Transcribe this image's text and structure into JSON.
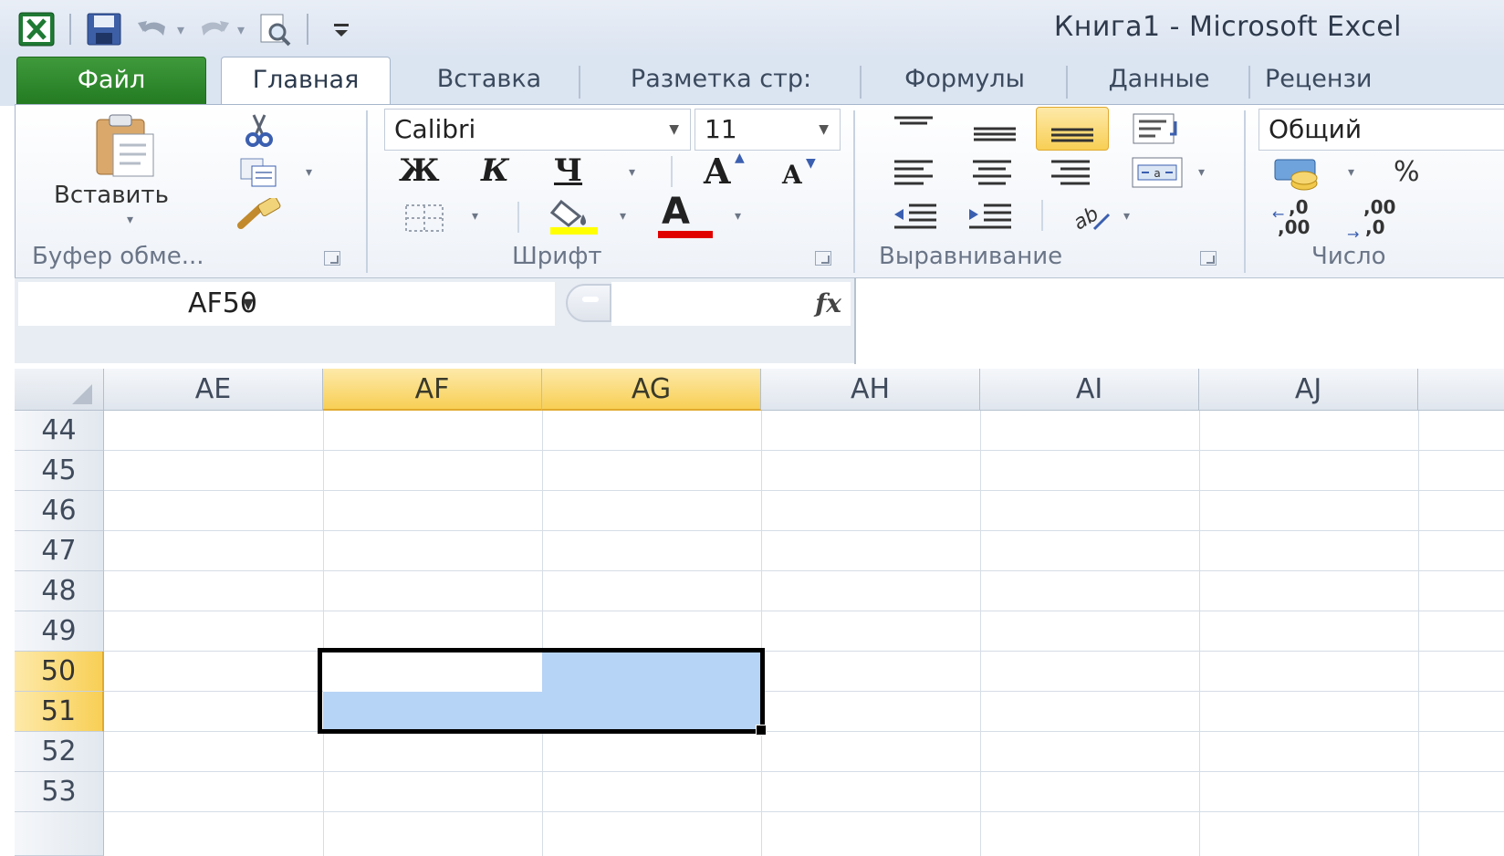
{
  "window": {
    "title": "Книга1  -  Microsoft Excel"
  },
  "ribbon": {
    "tabs": [
      {
        "label": "Файл"
      },
      {
        "label": "Главная"
      },
      {
        "label": "Вставка"
      },
      {
        "label": "Разметка стр:"
      },
      {
        "label": "Формулы"
      },
      {
        "label": "Данные"
      },
      {
        "label": "Рецензи"
      }
    ],
    "clipboard": {
      "paste_label": "Вставить",
      "group_label": "Буфер обме..."
    },
    "font": {
      "font_name": "Calibri",
      "font_size": "11",
      "bold_label": "Ж",
      "italic_label": "К",
      "underline_label": "Ч",
      "grow_label": "A",
      "shrink_label": "A",
      "font_color_label": "A",
      "group_label": "Шрифт",
      "fill_color": "#ffff00",
      "font_color": "#e00000"
    },
    "alignment": {
      "group_label": "Выравнивание"
    },
    "number": {
      "format": "Общий",
      "percent_label": "%",
      "inc_decimal_label": ",00",
      "dec_decimal_label": ",00",
      "group_label": "Число"
    }
  },
  "formula_bar": {
    "name_box": "AF50",
    "fx_label": "fx",
    "value": ""
  },
  "sheet": {
    "columns": [
      "AE",
      "AF",
      "AG",
      "AH",
      "AI",
      "AJ"
    ],
    "selected_columns": [
      "AF",
      "AG"
    ],
    "rows": [
      "44",
      "45",
      "46",
      "47",
      "48",
      "49",
      "50",
      "51",
      "52",
      "53"
    ],
    "selected_rows": [
      "50",
      "51"
    ],
    "active_cell": "AF50",
    "selection_range": "AF50:AG51",
    "selection_color": "#b6d4f5",
    "header_highlight": "#f8cf55"
  }
}
